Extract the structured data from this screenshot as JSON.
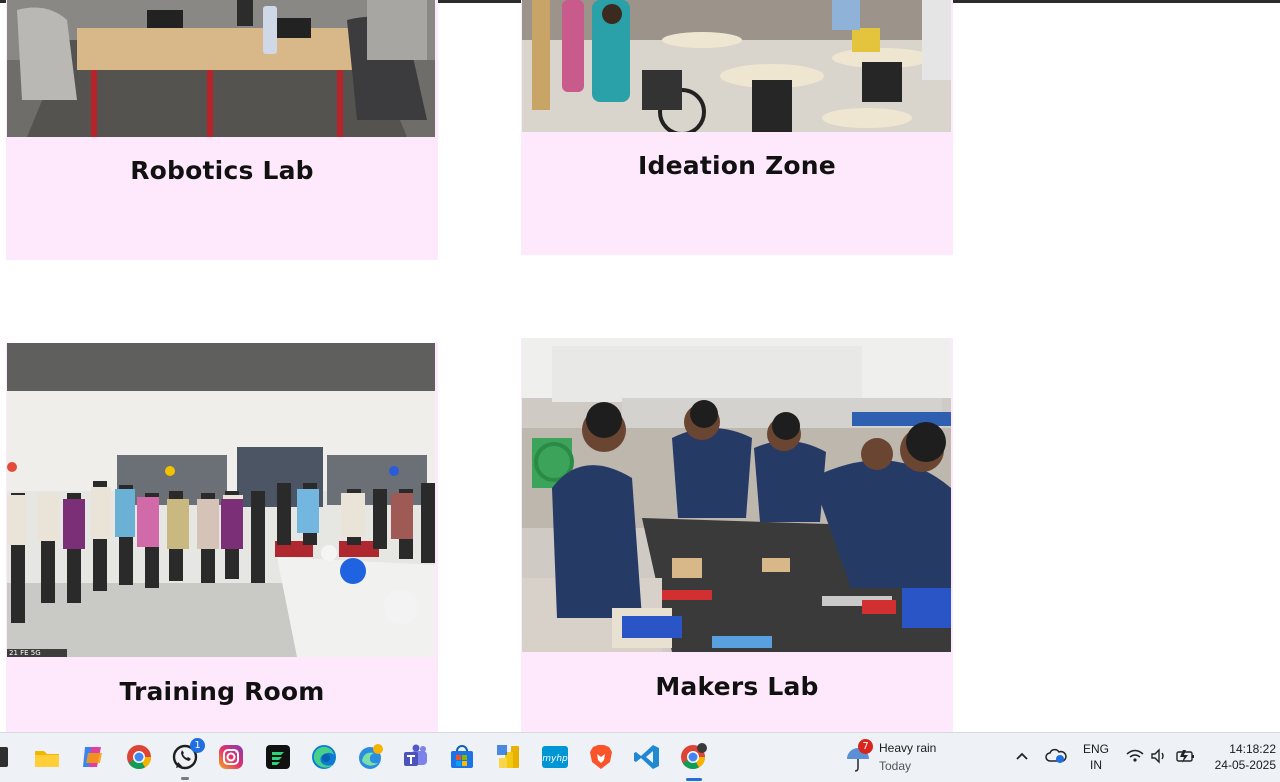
{
  "cards": [
    {
      "title": "Robotics Lab"
    },
    {
      "title": "Ideation Zone"
    },
    {
      "title": "Training Room"
    },
    {
      "title": "Makers Lab"
    }
  ],
  "training_photo_watermark": "21 FE 5G",
  "taskbar": {
    "apps": [
      {
        "name": "file-explorer-icon"
      },
      {
        "name": "copilot-icon"
      },
      {
        "name": "chrome-icon"
      },
      {
        "name": "whatsapp-icon",
        "badge": "1"
      },
      {
        "name": "instagram-icon"
      },
      {
        "name": "app-icon"
      },
      {
        "name": "edge-icon"
      },
      {
        "name": "edge-beta-icon"
      },
      {
        "name": "teams-icon"
      },
      {
        "name": "microsoft-store-icon"
      },
      {
        "name": "power-bi-icon"
      },
      {
        "name": "myhp-icon",
        "label": "myhp"
      },
      {
        "name": "brave-icon"
      },
      {
        "name": "vscode-icon"
      },
      {
        "name": "chrome-active-icon"
      }
    ],
    "weather": {
      "badge": "7",
      "title": "Heavy rain",
      "subtitle": "Today"
    },
    "language": {
      "line1": "ENG",
      "line2": "IN"
    },
    "clock": {
      "time": "14:18:22",
      "date": "24-05-2025"
    },
    "colors": {
      "accent": "#1f6fe0",
      "card_bg": "#fde9fb",
      "taskbar_bg": "#eef1f6"
    }
  }
}
